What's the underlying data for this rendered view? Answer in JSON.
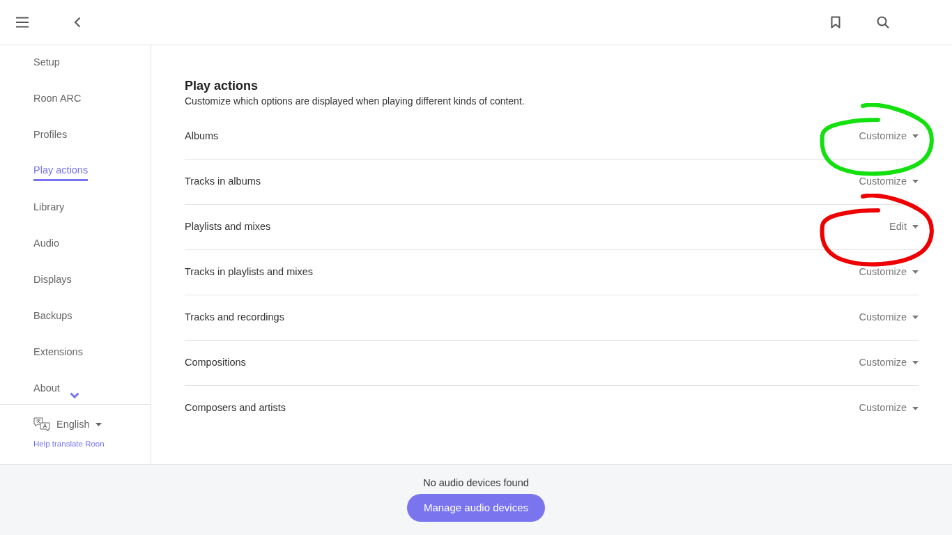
{
  "sidebar": {
    "items": [
      {
        "label": "Setup",
        "selected": false
      },
      {
        "label": "Roon ARC",
        "selected": false
      },
      {
        "label": "Profiles",
        "selected": false
      },
      {
        "label": "Play actions",
        "selected": true
      },
      {
        "label": "Library",
        "selected": false
      },
      {
        "label": "Audio",
        "selected": false
      },
      {
        "label": "Displays",
        "selected": false
      },
      {
        "label": "Backups",
        "selected": false
      },
      {
        "label": "Extensions",
        "selected": false
      },
      {
        "label": "About",
        "selected": false
      }
    ],
    "language": "English",
    "translate_link": "Help translate Roon"
  },
  "section": {
    "title": "Play actions",
    "description": "Customize which options are displayed when playing different kinds of content."
  },
  "rows": [
    {
      "label": "Albums",
      "action": "Customize",
      "annotation": {
        "color": "#14e010"
      }
    },
    {
      "label": "Tracks in albums",
      "action": "Customize"
    },
    {
      "label": "Playlists and mixes",
      "action": "Edit",
      "annotation": {
        "color": "#ee0000"
      }
    },
    {
      "label": "Tracks in playlists and mixes",
      "action": "Customize"
    },
    {
      "label": "Tracks and recordings",
      "action": "Customize"
    },
    {
      "label": "Compositions",
      "action": "Customize"
    },
    {
      "label": "Composers and artists",
      "action": "Customize"
    }
  ],
  "footer": {
    "message": "No audio devices found",
    "button": "Manage audio devices"
  }
}
